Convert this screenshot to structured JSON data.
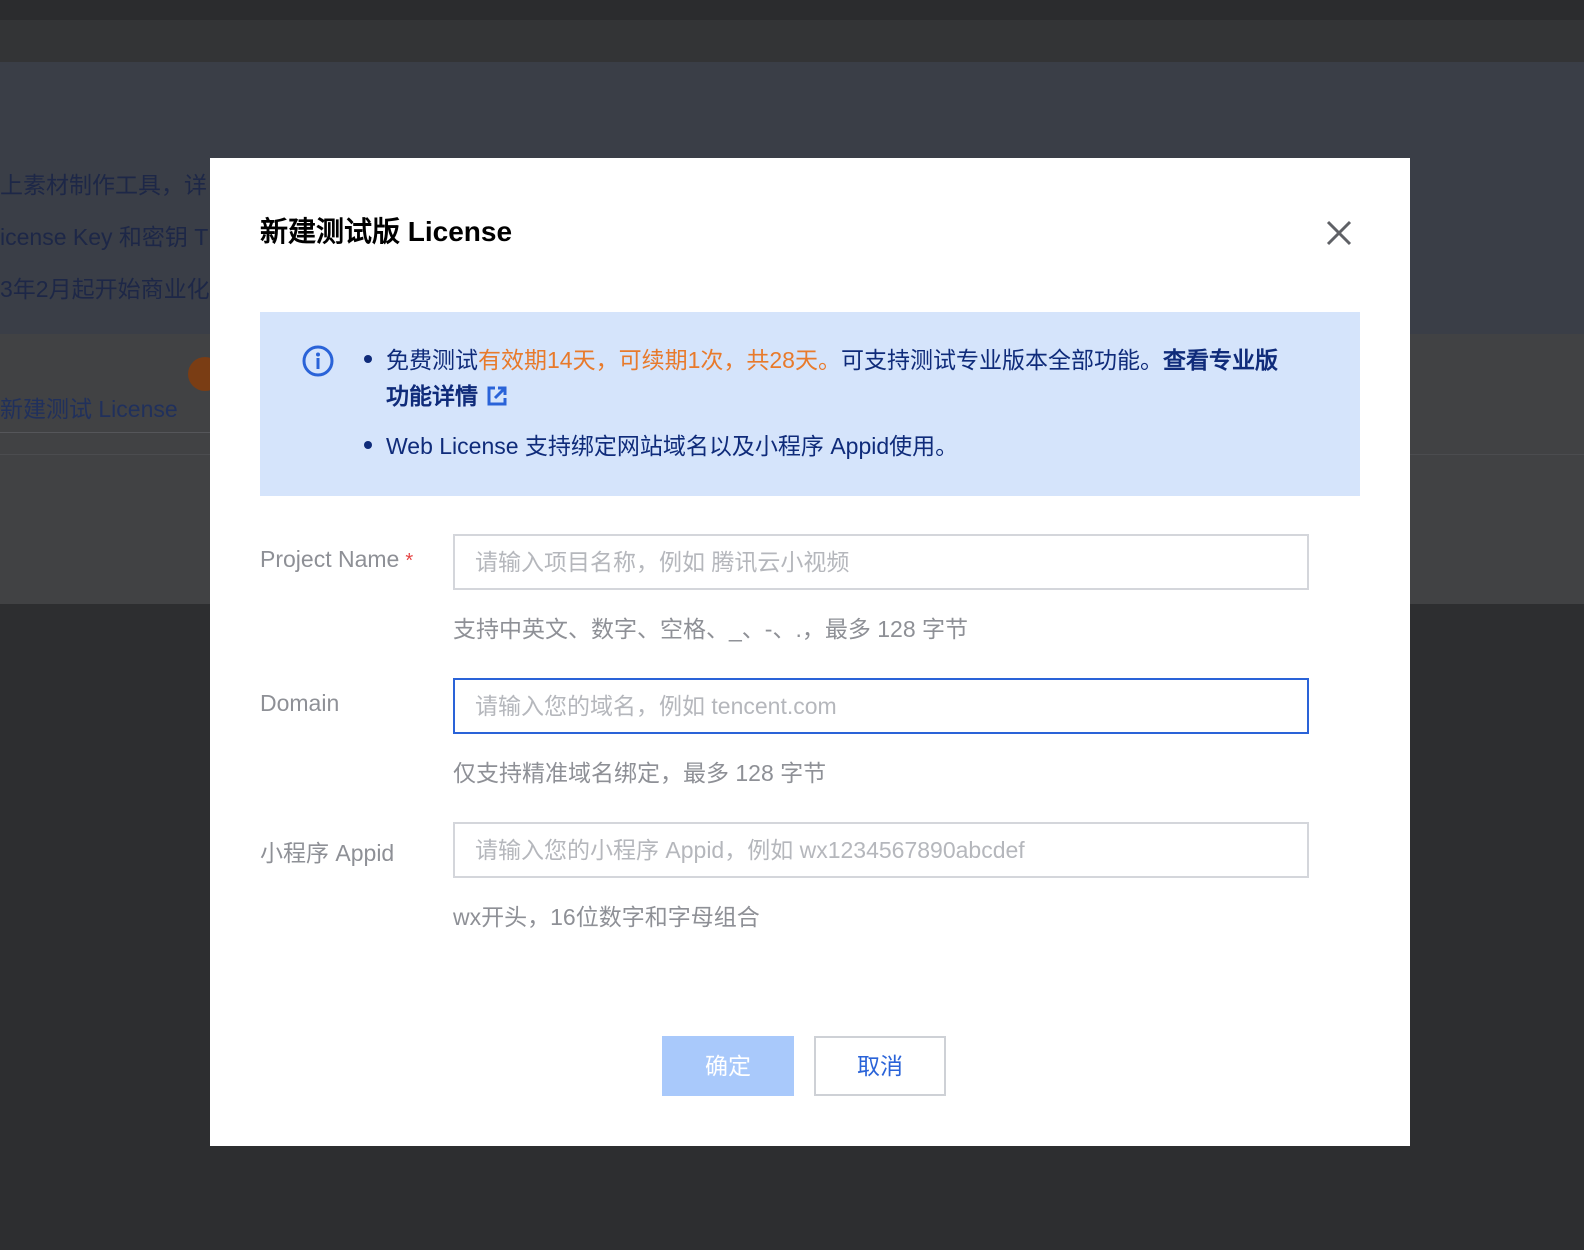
{
  "background": {
    "banner_lines": [
      "上素材制作工具，详",
      "icense Key 和密钥 T",
      "3年2月起开始商业化"
    ],
    "tab_label": "新建测试 License"
  },
  "modal": {
    "title": "新建测试版 License",
    "close_icon": "close-icon",
    "info": {
      "icon": "info-circle-icon",
      "item1": {
        "prefix": "免费测试",
        "highlight": "有效期14天，可续期1次，共28天。",
        "suffix": "可支持测试专业版本全部功能。",
        "link": "查看专业版功能详情",
        "link_icon": "external-link-icon"
      },
      "item2": "Web License 支持绑定网站域名以及小程序 Appid使用。"
    },
    "fields": {
      "project_name": {
        "label": "Project Name",
        "required": "*",
        "placeholder": "请输入项目名称，例如 腾讯云小视频",
        "value": "",
        "hint": "支持中英文、数字、空格、_、-、.，最多 128 字节"
      },
      "domain": {
        "label": "Domain",
        "placeholder": "请输入您的域名，例如 tencent.com",
        "value": "",
        "hint": "仅支持精准域名绑定，最多 128 字节"
      },
      "appid": {
        "label": "小程序 Appid",
        "placeholder": "请输入您的小程序 Appid，例如 wx1234567890abcdef",
        "value": "",
        "hint": "wx开头，16位数字和字母组合"
      }
    },
    "buttons": {
      "confirm": "确定",
      "cancel": "取消"
    }
  },
  "colors": {
    "accent": "#2a63d8",
    "highlight": "#e87a2b",
    "info_bg": "#d5e4fb",
    "confirm_disabled": "#a9c9fb",
    "required": "#e54545"
  }
}
